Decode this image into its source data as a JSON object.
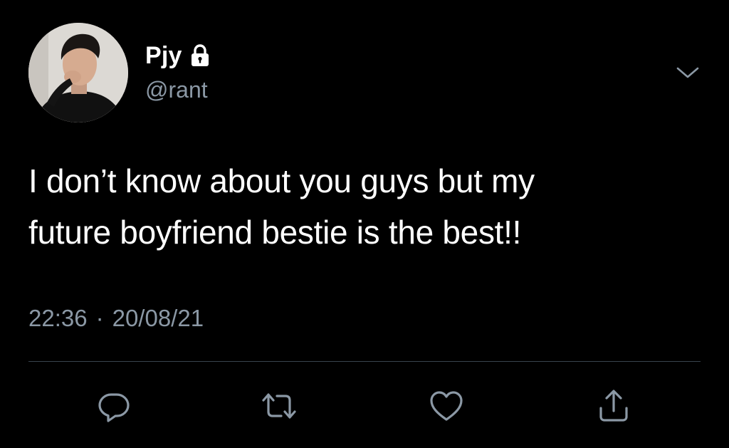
{
  "tweet": {
    "display_name": "Pjy",
    "handle": "@rant",
    "text_line1": "I don’t know about you guys but my",
    "text_line2": "future boyfriend bestie is the best!!",
    "time": "22:36",
    "separator": "·",
    "date": "20/08/21",
    "protected_icon": "lock-icon",
    "menu_icon": "chevron-down-icon"
  },
  "actions": {
    "reply_icon": "reply-icon",
    "retweet_icon": "retweet-icon",
    "like_icon": "heart-icon",
    "share_icon": "share-icon"
  },
  "colors": {
    "background": "#000000",
    "text": "#ffffff",
    "secondary": "#8b98a5",
    "divider": "#38444d"
  }
}
